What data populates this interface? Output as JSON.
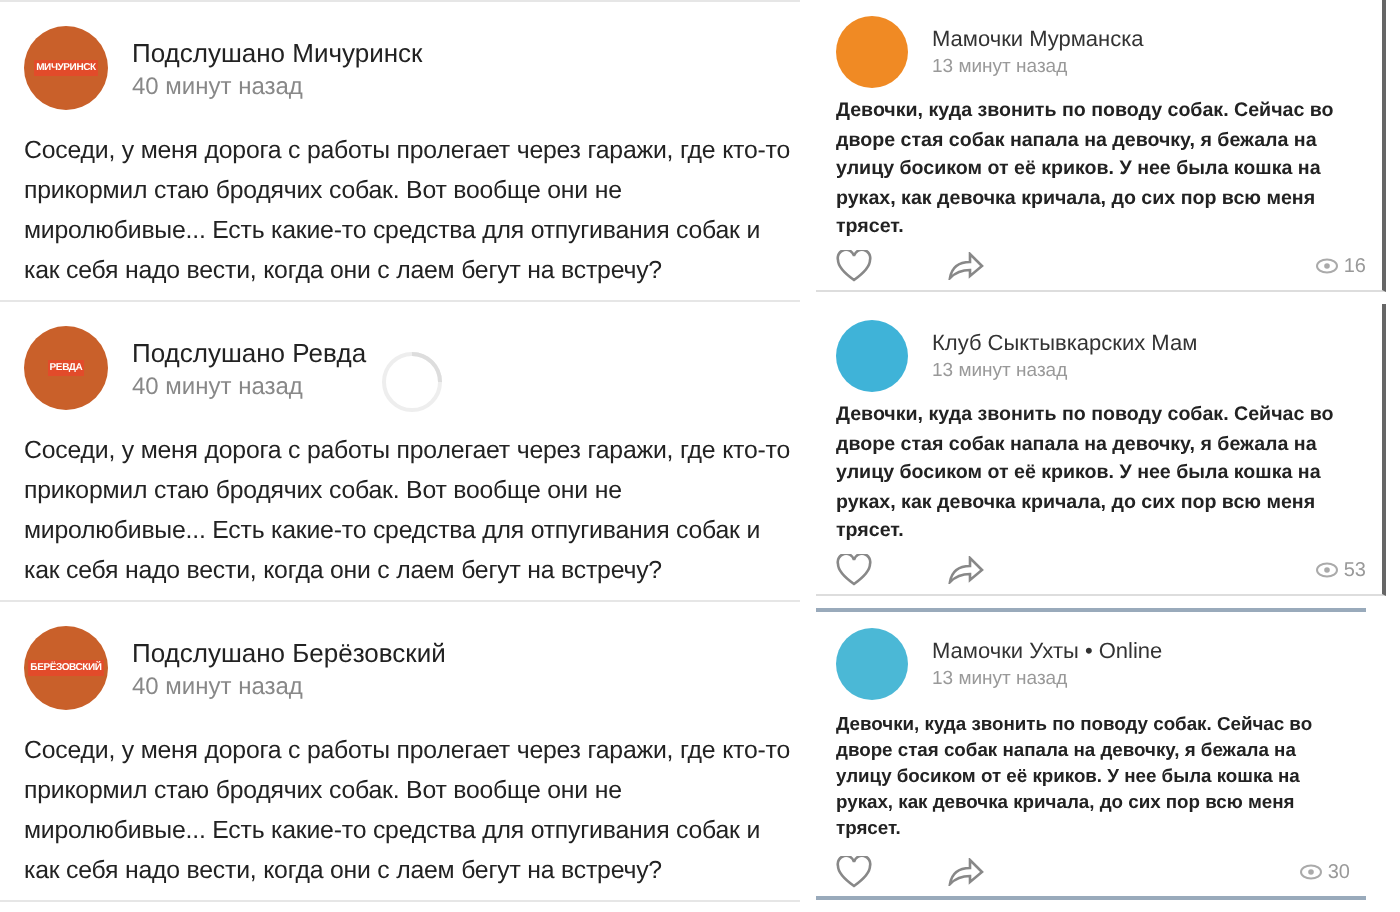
{
  "left_posts": [
    {
      "author": "Подслушано Мичуринск",
      "avatar_label": "МИЧУРИНСК",
      "time": "40 минут назад",
      "loading": false,
      "text": "Соседи, у меня дорога с работы пролегает через гаражи, где кто-то прикормил стаю бродячих собак. Вот вообще они не миролюбивые... Есть какие-то средства для отпугивания собак и как себя надо вести, когда они с лаем бегут на встречу?"
    },
    {
      "author": "Подслушано Ревда",
      "avatar_label": "РЕВДА",
      "time": "40 минут назад",
      "loading": true,
      "text": "Соседи, у меня дорога с работы пролегает через гаражи, где кто-то прикормил стаю бродячих собак. Вот вообще они не миролюбивые... Есть какие-то средства для отпугивания собак и как себя надо вести, когда они с лаем бегут на встречу?"
    },
    {
      "author": "Подслушано Берёзовский",
      "avatar_label": "БЕРЁЗОВСКИЙ",
      "time": "40 минут назад",
      "loading": false,
      "text": "Соседи, у меня дорога с работы пролегает через гаражи, где кто-то прикормил стаю бродячих собак. Вот вообще они не миролюбивые... Есть какие-то средства для отпугивания собак и как себя надо вести, когда они с лаем бегут на встречу?"
    }
  ],
  "right_posts": [
    {
      "author": "Мамочки Мурманска",
      "color": "#f08a24",
      "time": "13 минут назад",
      "text": "Девочки, куда звонить по поводу собак. Сейчас во дворе стая собак напала на девочку, я бежала на улицу босиком от её криков. У нее была кошка на руках, как девочка кричала, до сих пор всю меня трясет.",
      "views": "16"
    },
    {
      "author": "Клуб Сыктывкарских Мам",
      "color": "#3fb3d8",
      "time": "13 минут назад",
      "text": "Девочки, куда звонить по поводу собак. Сейчас во дворе стая собак напала на девочку, я бежала на улицу босиком от её криков. У нее была кошка на руках, как девочка кричала, до сих пор всю меня трясет.",
      "views": "53"
    },
    {
      "author": "Мамочки Ухты • Online",
      "color": "#4bb8d6",
      "time": "13 минут назад",
      "text": "Девочки, куда звонить по поводу собак. Сейчас во дворе стая собак напала на девочку, я бежала на улицу босиком от её криков. У нее была кошка на руках, как девочка кричала, до сих пор всю меня трясет.",
      "views": "30"
    }
  ]
}
